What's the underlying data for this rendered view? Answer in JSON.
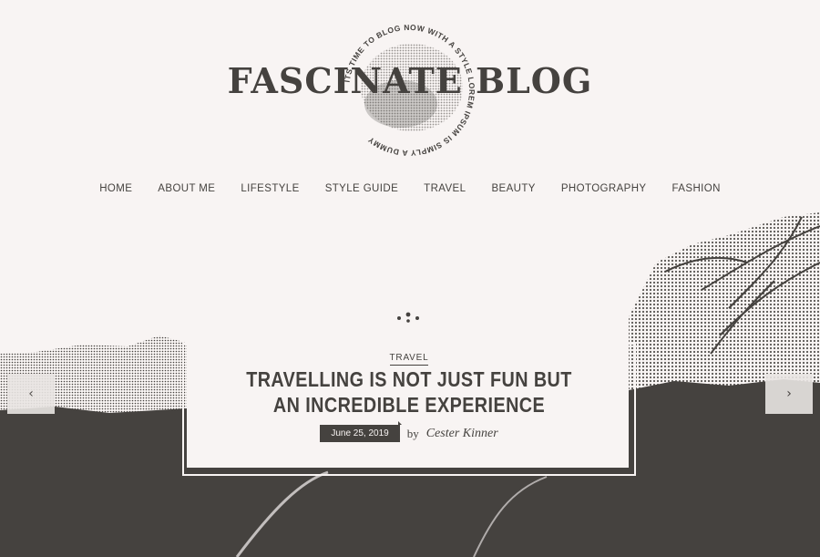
{
  "logo": {
    "title": "FASCINATE BLOG",
    "ring_text": "ITS TIME TO BLOG NOW WITH A STYLE LOREM IPSUM IS SIMPLY A DUMMY"
  },
  "nav": {
    "items": [
      "HOME",
      "ABOUT ME",
      "LIFESTYLE",
      "STYLE GUIDE",
      "TRAVEL",
      "BEAUTY",
      "PHOTOGRAPHY",
      "FASHION"
    ]
  },
  "slider": {
    "prev_icon": "chevron-left-icon",
    "prev_glyph": "‹",
    "next_icon": "chevron-right-icon",
    "next_glyph": "›"
  },
  "post": {
    "category": "TRAVEL",
    "title": "TRAVELLING IS NOT JUST FUN BUT AN INCREDIBLE EXPERIENCE",
    "date": "June 25, 2019",
    "by": "by",
    "author": "Cester Kinner"
  },
  "colors": {
    "ink": "#45423f",
    "paper": "#f8f4f3"
  }
}
